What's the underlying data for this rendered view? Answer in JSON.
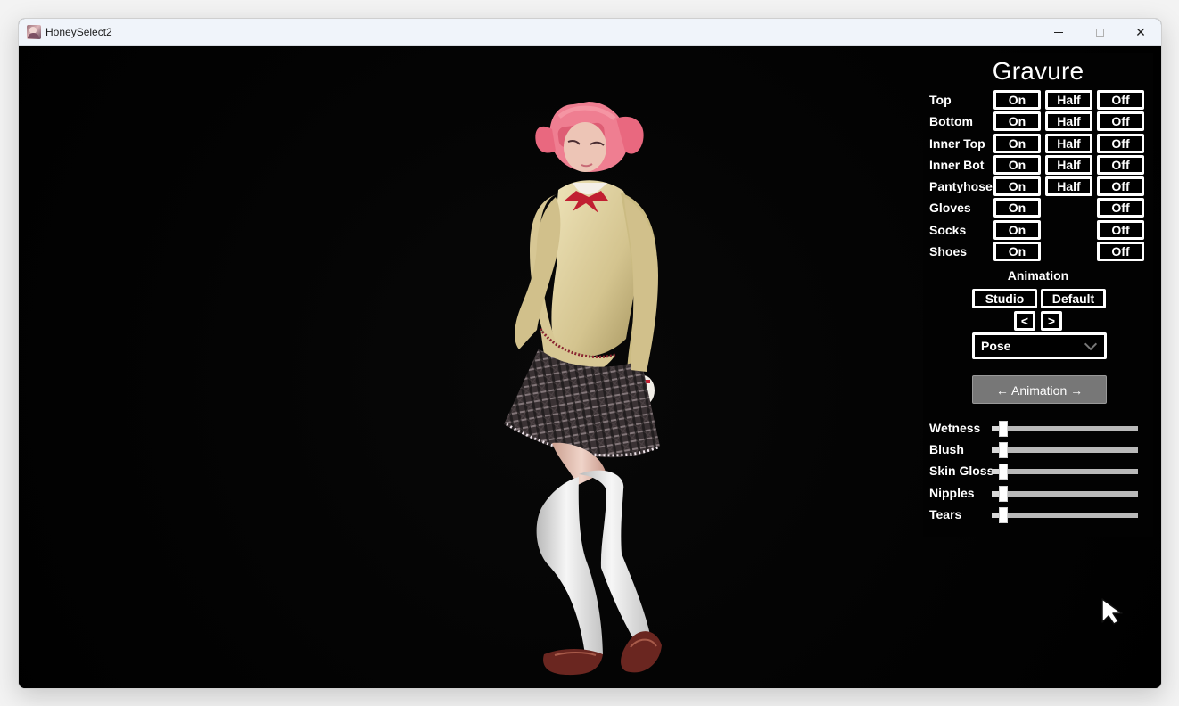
{
  "window": {
    "title": "HoneySelect2",
    "icon": "app-icon",
    "controls": {
      "minimize": "minimize-icon",
      "maximize": "maximize-icon",
      "close": "✕"
    }
  },
  "panel": {
    "title": "Gravure",
    "clothes": [
      {
        "label": "Top",
        "on": "On",
        "half": "Half",
        "off": "Off"
      },
      {
        "label": "Bottom",
        "on": "On",
        "half": "Half",
        "off": "Off"
      },
      {
        "label": "Inner Top",
        "on": "On",
        "half": "Half",
        "off": "Off"
      },
      {
        "label": "Inner Bot",
        "on": "On",
        "half": "Half",
        "off": "Off"
      },
      {
        "label": "Pantyhose",
        "on": "On",
        "half": "Half",
        "off": "Off"
      },
      {
        "label": "Gloves",
        "on": "On",
        "half": "",
        "off": "Off"
      },
      {
        "label": "Socks",
        "on": "On",
        "half": "",
        "off": "Off"
      },
      {
        "label": "Shoes",
        "on": "On",
        "half": "",
        "off": "Off"
      }
    ],
    "animation": {
      "section_label": "Animation",
      "studio": "Studio",
      "default": "Default",
      "prev": "<",
      "next": ">",
      "pose": "Pose",
      "button": "← Animation →"
    },
    "sliders": [
      {
        "label": "Wetness",
        "value": 0.08
      },
      {
        "label": "Blush",
        "value": 0.08
      },
      {
        "label": "Skin Gloss",
        "value": 0.08
      },
      {
        "label": "Nipples",
        "value": 0.08
      },
      {
        "label": "Tears",
        "value": 0.08
      }
    ]
  },
  "colors": {
    "scene_background": "#000000",
    "panel_text": "#ffffff",
    "button_border": "#ffffff",
    "animation_button": "#777777",
    "slider_track": "#b9b9b9"
  }
}
